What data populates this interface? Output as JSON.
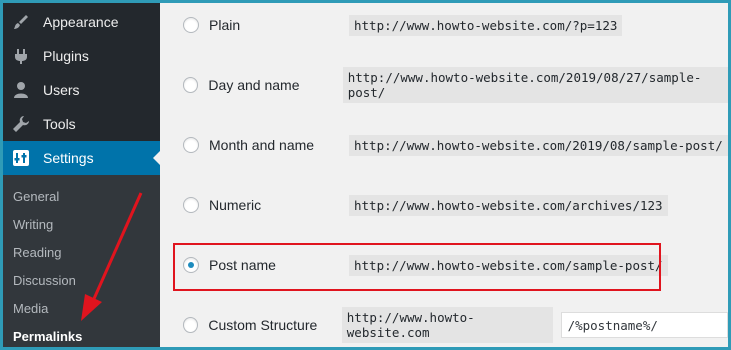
{
  "sidebar": {
    "items": [
      {
        "label": "Appearance",
        "icon": "paintbrush-icon"
      },
      {
        "label": "Plugins",
        "icon": "plugin-icon"
      },
      {
        "label": "Users",
        "icon": "users-icon"
      },
      {
        "label": "Tools",
        "icon": "wrench-icon"
      },
      {
        "label": "Settings",
        "icon": "settings-icon",
        "active": true
      }
    ],
    "submenu": [
      "General",
      "Writing",
      "Reading",
      "Discussion",
      "Media",
      "Permalinks"
    ],
    "current_submenu": "Permalinks"
  },
  "permalinks": {
    "options": [
      {
        "label": "Plain",
        "example": "http://www.howto-website.com/?p=123",
        "checked": false
      },
      {
        "label": "Day and name",
        "example": "http://www.howto-website.com/2019/08/27/sample-post/",
        "checked": false
      },
      {
        "label": "Month and name",
        "example": "http://www.howto-website.com/2019/08/sample-post/",
        "checked": false
      },
      {
        "label": "Numeric",
        "example": "http://www.howto-website.com/archives/123",
        "checked": false
      },
      {
        "label": "Post name",
        "example": "http://www.howto-website.com/sample-post/",
        "checked": true
      },
      {
        "label": "Custom Structure",
        "example": "http://www.howto-website.com",
        "checked": false,
        "value": "/%postname%/"
      }
    ]
  },
  "colors": {
    "sidebar_bg": "#23282d",
    "active_bg": "#0073aa",
    "annotation_red": "#e0141e",
    "frame_border": "#2f9bb7"
  }
}
